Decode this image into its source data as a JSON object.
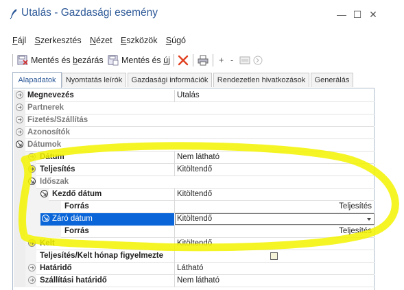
{
  "window": {
    "title": "Utalás - Gazdasági esemény",
    "minimize": "—",
    "maximize": "☐",
    "close": "✕"
  },
  "menu": [
    {
      "pre": "",
      "u": "F",
      "post": "ájl"
    },
    {
      "pre": "",
      "u": "S",
      "post": "zerkesztés"
    },
    {
      "pre": "",
      "u": "N",
      "post": "ézet"
    },
    {
      "pre": "",
      "u": "E",
      "post": "szközök"
    },
    {
      "pre": "",
      "u": "S",
      "post": "úgó"
    }
  ],
  "toolbar": {
    "save_close_pre": "Mentés és ",
    "save_close_u": "b",
    "save_close_post": "ezárás",
    "save_new_pre": "Mentés és ",
    "save_new_u": "ú",
    "save_new_post": "j",
    "plus": "+",
    "minus": "-"
  },
  "tabs": [
    "Alapadatok",
    "Nyomtatás leírók",
    "Gazdasági információk",
    "Rendezetlen hivatkozások",
    "Generálás"
  ],
  "rows": [
    {
      "label": "Megnevezés",
      "value": "Utalás"
    },
    {
      "label": "Partnerek",
      "value": ""
    },
    {
      "label": "Fizetés/Szállítás",
      "value": ""
    },
    {
      "label": "Azonosítók",
      "value": ""
    },
    {
      "label": "Dátumok",
      "value": ""
    },
    {
      "label": "Dátum",
      "value": "Nem látható"
    },
    {
      "label": "Teljesítés",
      "value": "Kitöltendő"
    },
    {
      "label": "Időszak",
      "value": ""
    },
    {
      "label": "Kezdő dátum",
      "value": "Kitöltendő"
    },
    {
      "label": "Forrás",
      "value": "Teljesítés"
    },
    {
      "label": "Záró dátum",
      "value": "Kitöltendő"
    },
    {
      "label": "Forrás",
      "value": "Teljesítés"
    },
    {
      "label": "Kelt",
      "value": "Kitöltendő"
    },
    {
      "label": "Teljesítés/Kelt hónap figyelmezte",
      "value": ""
    },
    {
      "label": "Határidő",
      "value": "Látható"
    },
    {
      "label": "Szállítási határidő",
      "value": "Nem látható"
    }
  ]
}
